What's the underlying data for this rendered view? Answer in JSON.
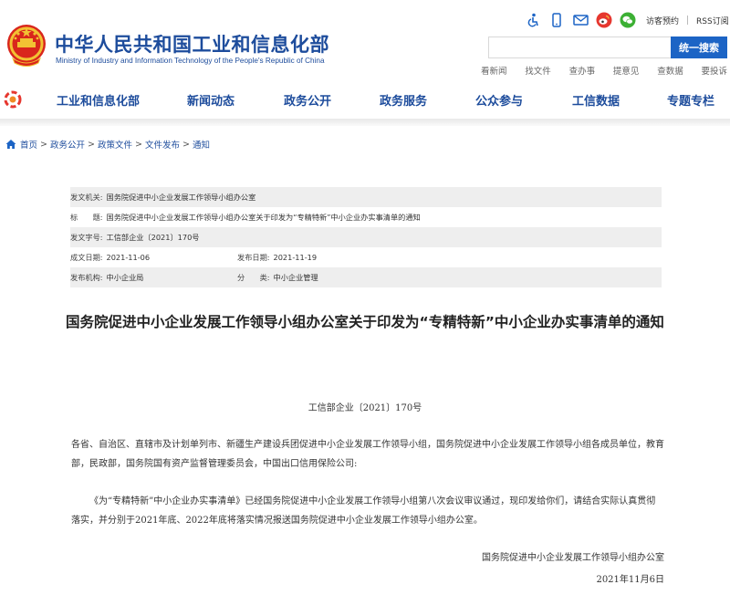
{
  "header": {
    "site_title": "中华人民共和国工业和信息化部",
    "site_subtitle": "Ministry of Industry and Information Technology of the People's Republic of China",
    "tools": {
      "visit_label": "访客预约",
      "rss_label": "RSS订阅"
    },
    "search": {
      "placeholder": "",
      "button_label": "统一搜索"
    },
    "quick_links": [
      "看新闻",
      "找文件",
      "查办事",
      "提意见",
      "查数据",
      "要投诉"
    ]
  },
  "nav": {
    "items": [
      "工业和信息化部",
      "新闻动态",
      "政务公开",
      "政务服务",
      "公众参与",
      "工信数据",
      "专题专栏"
    ]
  },
  "breadcrumb": [
    "首页",
    "政务公开",
    "政策文件",
    "文件发布",
    "通知"
  ],
  "info": {
    "issuer_label": "发文机关:",
    "issuer": "国务院促进中小企业发展工作领导小组办公室",
    "title_label": "标　　题:",
    "title": "国务院促进中小企业发展工作领导小组办公室关于印发为“专精特新”中小企业办实事清单的通知",
    "docno_label": "发文字号:",
    "docno": "工信部企业〔2021〕170号",
    "created_label": "成文日期:",
    "created": "2021-11-06",
    "published_label": "发布日期:",
    "published": "2021-11-19",
    "agency_label": "发布机构:",
    "agency": "中小企业局",
    "category_label": "分　　类:",
    "category": "中小企业管理"
  },
  "article": {
    "title": "国务院促进中小企业发展工作领导小组办公室关于印发为“专精特新”中小企业办实事清单的通知",
    "doc_number": "工信部企业〔2021〕170号",
    "paragraph1": "各省、自治区、直辖市及计划单列市、新疆生产建设兵团促进中小企业发展工作领导小组，国务院促进中小企业发展工作领导小组各成员单位，教育部，民政部，国务院国有资产监督管理委员会，中国出口信用保险公司:",
    "paragraph2": "《为“专精特新”中小企业办实事清单》已经国务院促进中小企业发展工作领导小组第八次会议审议通过，现印发给你们，请结合实际认真贯彻落实，并分别于2021年底、2022年底将落实情况报送国务院促进中小企业发展工作领导小组办公室。",
    "sign_org": "国务院促进中小企业发展工作领导小组办公室",
    "sign_date": "2021年11月6日"
  },
  "colors": {
    "brand_blue": "#1d4c9c",
    "search_button": "#1c64c5",
    "table_grey": "#eeeeee"
  },
  "icons": [
    "national-emblem",
    "accessibility-icon",
    "mobile-icon",
    "mail-icon",
    "weibo-icon",
    "wechat-icon",
    "nav-logo-icon",
    "home-icon"
  ]
}
